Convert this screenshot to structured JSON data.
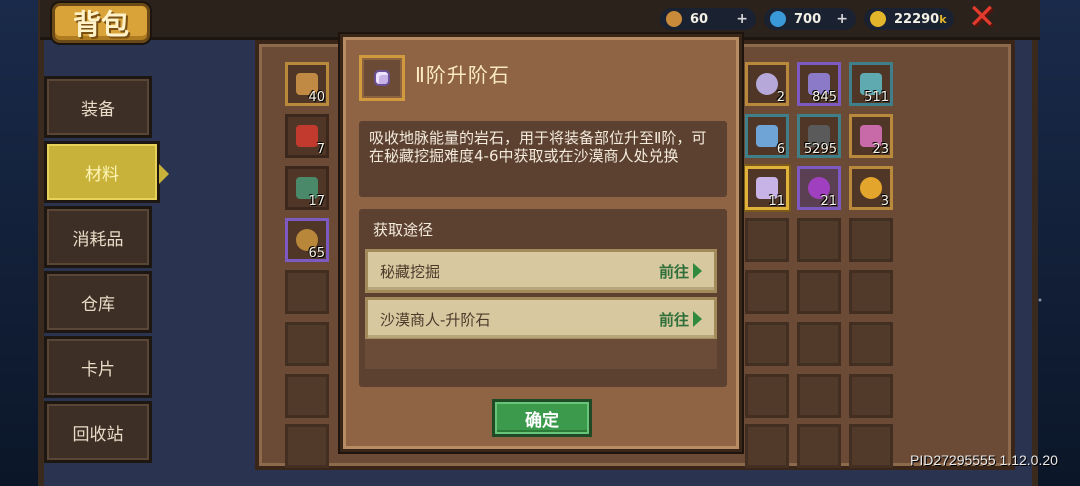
{
  "header": {
    "title": "背包",
    "resources": [
      {
        "name": "currency-1",
        "value": "60",
        "plus": "+",
        "color": "#c98a3a"
      },
      {
        "name": "currency-2",
        "value": "700",
        "plus": "+",
        "color": "#3a9ad9"
      },
      {
        "name": "gold",
        "value": "22290",
        "suffix": "k",
        "color": "#e3b52b"
      }
    ],
    "close_icon": "close-x-icon"
  },
  "sidebar": {
    "tabs": [
      {
        "label": "装备",
        "active": false
      },
      {
        "label": "材料",
        "active": true
      },
      {
        "label": "消耗品",
        "active": false
      },
      {
        "label": "仓库",
        "active": false
      },
      {
        "label": "卡片",
        "active": false
      },
      {
        "label": "回收站",
        "active": false
      }
    ]
  },
  "inventory": {
    "left_items": [
      {
        "qty": "40",
        "icon": "key-icon",
        "color": "#c08a45"
      },
      {
        "qty": "7",
        "icon": "red-crystal-icon",
        "color": "#c23a2e"
      },
      {
        "qty": "17",
        "icon": "map-scroll-icon",
        "color": "#4a8a6a"
      },
      {
        "qty": "65",
        "icon": "cookie-icon",
        "color": "#b8873a"
      }
    ],
    "right_items": [
      {
        "qty": "2",
        "icon": "pearl-icon",
        "color": "#b6a8d8"
      },
      {
        "qty": "845",
        "icon": "gem-shard-icon",
        "color": "#8a7ac8"
      },
      {
        "qty": "511",
        "icon": "crystal-icon",
        "color": "#5fa9b0"
      },
      {
        "qty": "6",
        "icon": "blue-scroll-icon",
        "color": "#6fa5d6"
      },
      {
        "qty": "5295",
        "icon": "iron-ore-icon",
        "color": "#5a5a5a"
      },
      {
        "qty": "23",
        "icon": "prism-icon",
        "color": "#c86aa8"
      },
      {
        "qty": "11",
        "icon": "upgrade-stone-icon",
        "color": "#c8b3e6"
      },
      {
        "qty": "21",
        "icon": "purple-planet-icon",
        "color": "#a040c0"
      },
      {
        "qty": "3",
        "icon": "gold-planet-icon",
        "color": "#e3a52b"
      }
    ]
  },
  "modal": {
    "icon": "upgrade-stone-icon",
    "title": "Ⅱ阶升阶石",
    "description": "吸收地脉能量的岩石，用于将装备部位升至Ⅱ阶，可在秘藏挖掘难度4-6中获取或在沙漠商人处兑换",
    "source_title": "获取途径",
    "sources": [
      {
        "label": "秘藏挖掘",
        "action": "前往"
      },
      {
        "label": "沙漠商人-升阶石",
        "action": "前往"
      }
    ],
    "confirm_label": "确定"
  },
  "footer": {
    "version": "PID27295555 1.12.0.20"
  }
}
